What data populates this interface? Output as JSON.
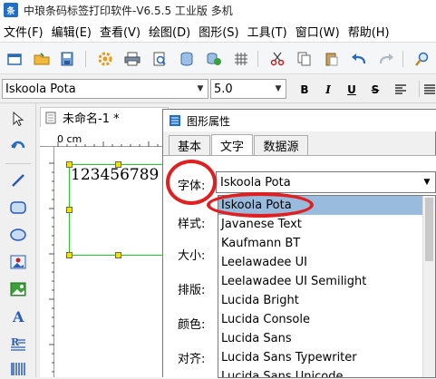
{
  "window": {
    "title": "中琅条码标签打印软件-V6.5.5 工业版 多机"
  },
  "menu": [
    "文件(F)",
    "编辑(E)",
    "查看(V)",
    "绘图(D)",
    "图形(S)",
    "工具(T)",
    "窗口(W)",
    "帮助(H)"
  ],
  "toolbar_icons": [
    "new-file-icon",
    "open-folder-icon",
    "save-icon",
    "settings-gear-icon",
    "print-icon",
    "print-preview-icon",
    "database-icon",
    "data-source-icon",
    "grid-icon",
    "cut-icon",
    "copy-icon",
    "paste-icon",
    "undo-icon",
    "redo-icon",
    "zoom-icon"
  ],
  "format_bar": {
    "font_name": "Iskoola Pota",
    "font_size": "5.0",
    "bold": "B",
    "italic": "I",
    "underline": "U",
    "strike": "S"
  },
  "left_tools": [
    "select-arrow-icon",
    "rotate-icon",
    "line-icon",
    "rounded-rect-icon",
    "ellipse-icon",
    "image-icon",
    "picture-icon",
    "text-icon",
    "rich-text-icon",
    "barcode-icon"
  ],
  "document": {
    "tab_title": "未命名-1 *",
    "ruler_unit": "0 cm",
    "barcode_text": "123456789"
  },
  "dialog": {
    "title": "图形属性",
    "tabs": [
      "基本",
      "文字",
      "数据源"
    ],
    "active_tab": "文字",
    "labels": {
      "font": "字体:",
      "style": "样式:",
      "size": "大小:",
      "layout": "排版:",
      "color": "颜色:",
      "align": "对齐:"
    },
    "font_value": "Iskoola Pota",
    "font_options": [
      "Iskoola Pota",
      "Javanese Text",
      "Kaufmann BT",
      "Leelawadee UI",
      "Leelawadee UI Semilight",
      "Lucida Bright",
      "Lucida Console",
      "Lucida Sans",
      "Lucida Sans Typewriter",
      "Lucida Sans Unicode"
    ],
    "selected_font_index": 0
  },
  "colors": {
    "highlight": "#e02020",
    "selection": "#99bbdd",
    "object_border": "#22cc22"
  }
}
